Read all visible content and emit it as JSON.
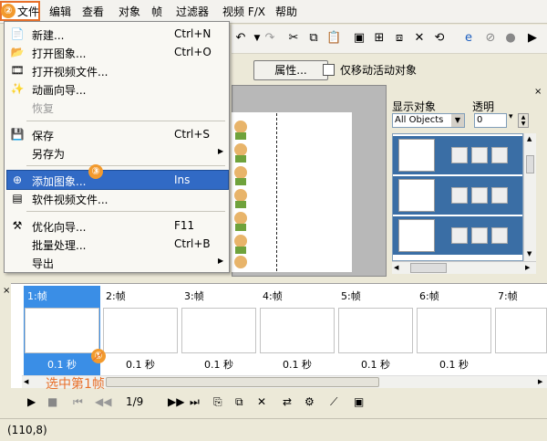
{
  "menubar": {
    "items": [
      "文件",
      "编辑",
      "查看",
      "对象",
      "帧",
      "过滤器",
      "视频 F/X",
      "帮助"
    ]
  },
  "properties_button": "属性...",
  "only_move_active_label": "仅移动活动对象",
  "right_panel": {
    "display_objects_label": "显示对象",
    "opacity_label": "透明",
    "objects_select_value": "All Objects",
    "opacity_value": "0"
  },
  "timeline": {
    "frames": [
      "1:帧",
      "2:帧",
      "3:帧",
      "4:帧",
      "5:帧",
      "6:帧",
      "7:帧"
    ],
    "durations": [
      "0.1 秒",
      "0.1 秒",
      "0.1 秒",
      "0.1 秒",
      "0.1 秒",
      "0.1 秒"
    ]
  },
  "playback": {
    "frame_counter": "1/9"
  },
  "status": {
    "coords": "(110,8)"
  },
  "file_menu": {
    "new": {
      "label": "新建...",
      "shortcut": "Ctrl+N"
    },
    "open_image": {
      "label": "打开图象...",
      "shortcut": "Ctrl+O"
    },
    "open_video": {
      "label": "打开视频文件..."
    },
    "animation_wizard": {
      "label": "动画向导..."
    },
    "restore": {
      "label": "恢复"
    },
    "save": {
      "label": "保存",
      "shortcut": "Ctrl+S"
    },
    "save_as": {
      "label": "另存为"
    },
    "add_image": {
      "label": "添加图象...",
      "shortcut": "Ins"
    },
    "software_video": {
      "label": "软件视频文件..."
    },
    "optimize_wizard": {
      "label": "优化向导...",
      "shortcut": "F11"
    },
    "batch": {
      "label": "批量处理...",
      "shortcut": "Ctrl+B"
    },
    "export": {
      "label": "导出"
    }
  },
  "annotations": {
    "step1_number": "①",
    "step2_number": "②",
    "step3_number": "③",
    "step1_text": "选中第1帧"
  },
  "colors": {
    "annotation": "#e8702a",
    "highlight": "#316ac5",
    "frame_selected": "#3a8ee6"
  }
}
